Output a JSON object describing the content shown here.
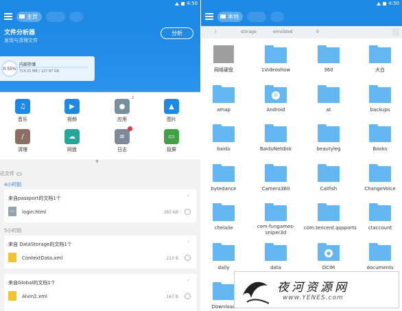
{
  "status_bar": {
    "time": "4:50"
  },
  "left": {
    "tab_home": "主页",
    "hero": {
      "title": "文件分析器",
      "subtitle": "发现与清理文件",
      "analyze_button": "分析"
    },
    "storage": {
      "percent_text": "0.55%",
      "used_fraction": 0.0055,
      "name": "内部存储",
      "size": "714.31 MB / 127.97 GB"
    },
    "categories": [
      {
        "label": "音乐",
        "icon": "music-note-icon",
        "color": "#1e88e5"
      },
      {
        "label": "视频",
        "icon": "video-play-icon",
        "color": "#1e88e5"
      },
      {
        "label": "应用",
        "icon": "android-robot-icon",
        "color": "#78909c",
        "badge": "2"
      },
      {
        "label": "图片",
        "icon": "picture-icon",
        "color": "#1e88e5"
      },
      {
        "label": "清理",
        "icon": "broom-icon",
        "color": "#8d6e63"
      },
      {
        "label": "网盘",
        "icon": "cloud-icon",
        "color": "#26a69a"
      },
      {
        "label": "日志",
        "icon": "layers-icon",
        "color": "#7e8896"
      },
      {
        "label": "投屏",
        "icon": "cast-screen-icon",
        "color": "#43a047"
      }
    ],
    "recent": {
      "header": "近文件",
      "groups": [
        {
          "time": "4小时前",
          "source": "来自passport的文档1个",
          "file": "login.html",
          "size": "365 KB",
          "icon_text": "<>"
        },
        {
          "time": "5小时前",
          "source": "来自 DataStorage的文档1个",
          "file": "ContextData.xml",
          "size": "213 B"
        },
        {
          "time": "",
          "source": "来自Global的文档1个",
          "file": "Alvin2.xml",
          "size": "167 B"
        }
      ]
    }
  },
  "right": {
    "tab_local": "本地",
    "path": [
      "/",
      "storage",
      "emulated",
      "0"
    ],
    "folders": [
      "网络硬盘",
      "1Videoshow",
      "360",
      "大白",
      "amap",
      "Android",
      "at",
      "backups",
      "baidu",
      "BaiduNetdisk",
      "beautyleg",
      "Books",
      "bytedance",
      "Camera360",
      "Catfish",
      "ChangeVoice",
      "chelaile",
      "com-fungames-sniper3d",
      "com.tencent.qqsports",
      "ctaccount",
      "daily",
      "data",
      "DCIM",
      "documents",
      "Download",
      "",
      "",
      ""
    ],
    "folder_color": "#63b6f1"
  },
  "watermark": {
    "text": "夜河资源网",
    "url": "www.YENES.com"
  }
}
